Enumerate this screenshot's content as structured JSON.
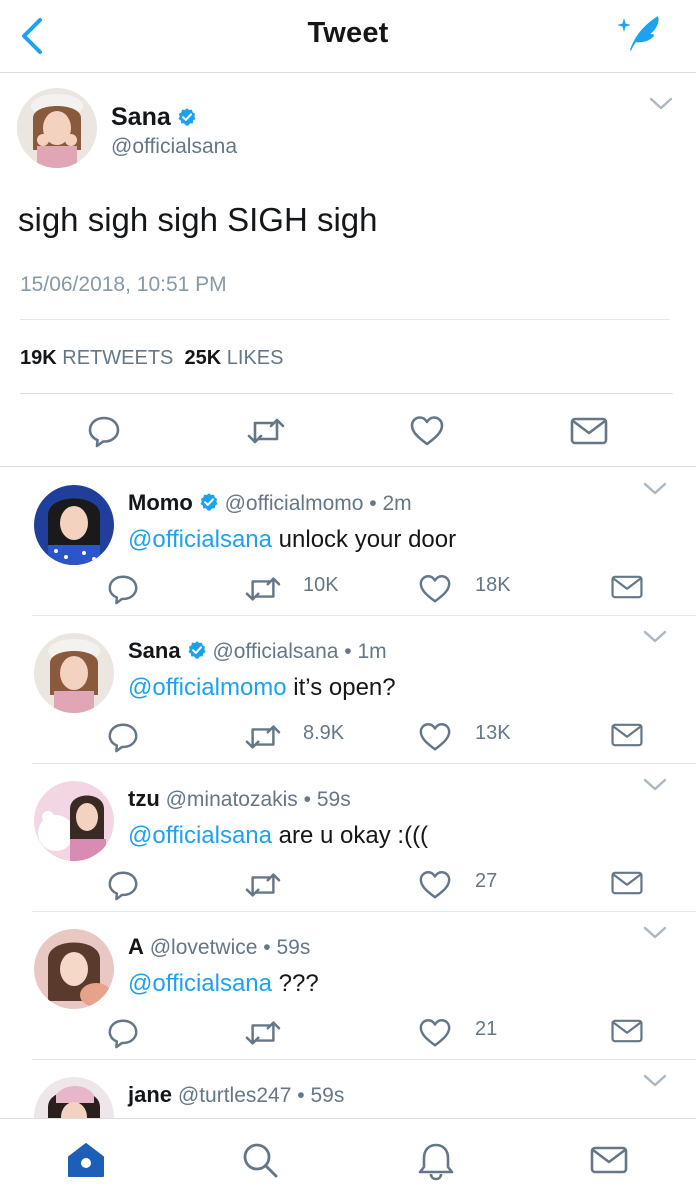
{
  "header": {
    "title": "Tweet"
  },
  "main_tweet": {
    "name": "Sana",
    "handle": "@officialsana",
    "text": "sigh sigh sigh SIGH sigh",
    "timestamp": "15/06/2018, 10:51 PM",
    "retweets_count": "19K",
    "retweets_label": "RETWEETS",
    "likes_count": "25K",
    "likes_label": "LIKES"
  },
  "replies": [
    {
      "name": "Momo",
      "verified": true,
      "handle": "@officialmomo",
      "time": "2m",
      "mention": "@officialsana",
      "text": " unlock your door",
      "retweets": "10K",
      "likes": "18K"
    },
    {
      "name": "Sana",
      "verified": true,
      "handle": "@officialsana",
      "time": "1m",
      "mention": "@officialmomo",
      "text": " it’s open?",
      "retweets": "8.9K",
      "likes": "13K"
    },
    {
      "name": "tzu",
      "verified": false,
      "handle": "@minatozakis",
      "time": "59s",
      "mention": "@officialsana",
      "text": " are u okay :(((",
      "retweets": "",
      "likes": "27"
    },
    {
      "name": "A",
      "verified": false,
      "handle": "@lovetwice",
      "time": "59s",
      "mention": "@officialsana",
      "text": " ???",
      "retweets": "",
      "likes": "21"
    },
    {
      "name": "jane",
      "verified": false,
      "handle": "@turtles247",
      "time": "59s"
    }
  ],
  "separator": "•",
  "colors": {
    "accent": "#1da1f2",
    "muted": "#657786",
    "verified": "#1da1f2"
  },
  "icons": [
    "back-chevron-icon",
    "compose-tweet-icon",
    "verified-badge-icon",
    "reply-icon",
    "retweet-icon",
    "like-icon",
    "message-icon",
    "home-icon",
    "search-icon",
    "notifications-icon",
    "mail-icon",
    "chevron-down-icon"
  ]
}
